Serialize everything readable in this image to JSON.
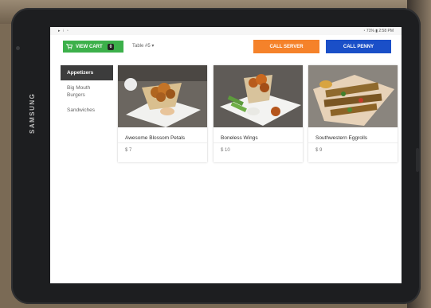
{
  "header": {
    "view_cart_label": "VIEW CART",
    "cart_count": "0",
    "table_label": "Table #5",
    "call_server_label": "CALL SERVER",
    "call_penny_label": "CALL PENNY"
  },
  "status": {
    "time": "2:58 PM",
    "battery": "71%"
  },
  "device": {
    "brand": "SAMSUNG"
  },
  "sidebar": {
    "items": [
      {
        "label": "Appetizers",
        "active": true
      },
      {
        "label": "Big Mouth Burgers",
        "active": false
      },
      {
        "label": "Sandwiches",
        "active": false
      }
    ]
  },
  "menu_items": [
    {
      "name": "Awesome Blossom Petals",
      "price": "$ 7"
    },
    {
      "name": "Boneless Wings",
      "price": "$ 10"
    },
    {
      "name": "Southwestern Eggrolls",
      "price": "$ 9"
    }
  ],
  "colors": {
    "view_cart": "#3cb04a",
    "call_server": "#f5822a",
    "call_penny": "#1a4fc8",
    "sidebar_active": "#3c3c3c"
  }
}
